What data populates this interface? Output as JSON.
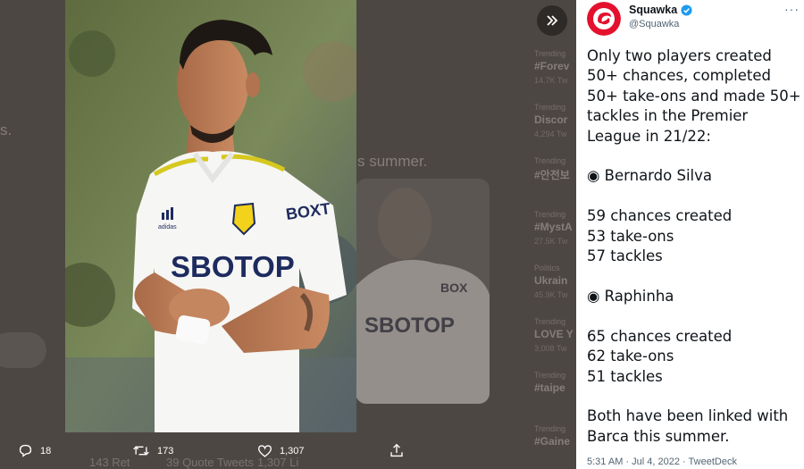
{
  "background": {
    "fragments": [
      "s.",
      "s summer."
    ],
    "trends": [
      {
        "meta": "Trending",
        "title": "#Forev",
        "sub": "14.7K Tw"
      },
      {
        "meta": "Trending",
        "title": "Discor",
        "sub": "4,294 Tw"
      },
      {
        "meta": "Trending",
        "title": "#안전보",
        "sub": ""
      },
      {
        "meta": "Trending",
        "title": "#MystA",
        "sub": "27.5K Tw"
      },
      {
        "meta": "Politics",
        "title": "Ukrain",
        "sub": "45.9K Tw"
      },
      {
        "meta": "Trending",
        "title": "LOVE Y",
        "sub": "3,008 Tw"
      },
      {
        "meta": "Trending",
        "title": "#taipe",
        "sub": ""
      },
      {
        "meta": "Trending",
        "title": "#Gaine",
        "sub": ""
      }
    ],
    "footer": [
      "143 Ret",
      "39 Quote Tweets",
      "1,307 Li"
    ]
  },
  "media": {
    "alt": "Footballer in white kit clapping",
    "shirt_sponsor": "SBOTOP",
    "shirt_sleeve": "BOXT"
  },
  "actions": {
    "reply_count": "18",
    "retweet_count": "173",
    "like_count": "1,307"
  },
  "tweet": {
    "display_name": "Squawka",
    "handle": "@Squawka",
    "more": "···",
    "text": "Only two players created 50+ chances, completed 50+ take-ons and made 50+ tackles in the Premier League in 21/22:\n\n◉ Bernardo Silva\n\n59 chances created\n53 take-ons\n57 tackles\n\n◉ Raphinha\n\n65 chances created\n62 take-ons\n51 tackles\n\nBoth have been linked with Barca this summer.",
    "timestamp": "5:31 AM · Jul 4, 2022 · TweetDeck"
  },
  "colors": {
    "brand_red": "#e3112d",
    "verified_blue": "#1d9bf0",
    "text_primary": "#0f1419",
    "text_secondary": "#536471"
  }
}
